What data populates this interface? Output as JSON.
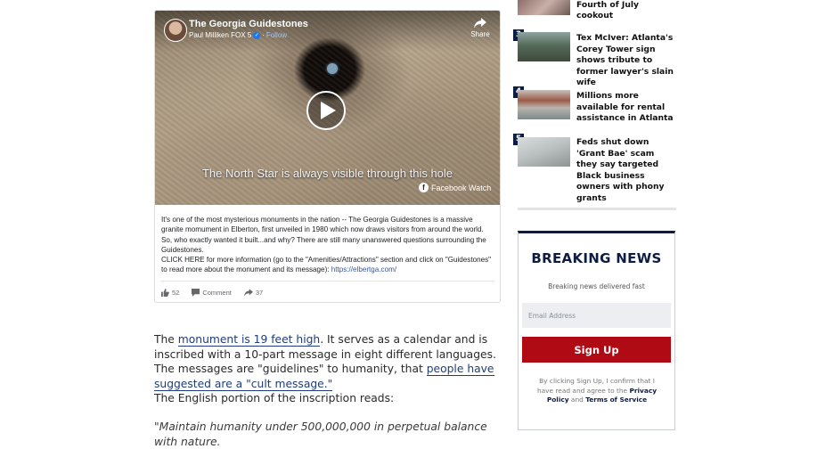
{
  "video": {
    "title": "The Georgia Guidestones",
    "author": "Paul Milliken FOX 5",
    "follow_label": "Follow",
    "share_label": "Share",
    "caption": "The North Star is always visible through this hole",
    "watch_label": "Facebook Watch",
    "description_1": "It's one of the most mysterious monuments in the nation -- The Georgia Guidestones is a massive granite momument in Elberton, first unveiled in 1980 which now draws visitors from around the world. So, who exactly wanted it built...and why? There are still many unanswered questions surrounding the Guidestones.",
    "description_2": "CLICK HERE for more information (go to the \"Amenities/Attractions\" section and click on \"Guidestones\" to read more about the monument and its message): ",
    "description_link": "https://elbertga.com/",
    "likes": "52",
    "comment_label": "Comment",
    "shares": "37"
  },
  "article": {
    "p1_a": "The ",
    "p1_link1": "monument is 19 feet high",
    "p1_b": ". It serves as a calendar and is inscribed with a 10-part message in eight different languages. The messages are \"guidelines\" to humanity, that ",
    "p1_link2": "people have suggested are a \"cult message.\"",
    "p2": "The English portion of the inscription reads:",
    "p3": "\"Maintain humanity under 500,000,000 in perpetual balance with nature."
  },
  "trending": [
    {
      "number": "",
      "title": "Georgia jail have Fourth of July cookout"
    },
    {
      "number": "3",
      "title": "Tex McIver: Atlanta's Corey Tower sign shows tribute to former lawyer's slain wife"
    },
    {
      "number": "4",
      "title": "Millions more available for rental assistance in Atlanta"
    },
    {
      "number": "5",
      "title": "Feds shut down 'Grant Bae' scam they say targeted Black business owners with phony grants"
    }
  ],
  "breaking": {
    "title": "BREAKING NEWS",
    "subtitle": "Breaking news delivered fast",
    "email_placeholder": "Email Address",
    "button": "Sign Up",
    "legal_1": "By clicking Sign Up, I confirm that I have read and agree to the ",
    "privacy": "Privacy Policy",
    "legal_2": " and ",
    "terms": "Terms of Service"
  },
  "colors": {
    "navy": "#0d1d42",
    "signup_red": "#b00b14",
    "link_blue": "#1f3d78",
    "facebook_blue": "#1877f2"
  }
}
